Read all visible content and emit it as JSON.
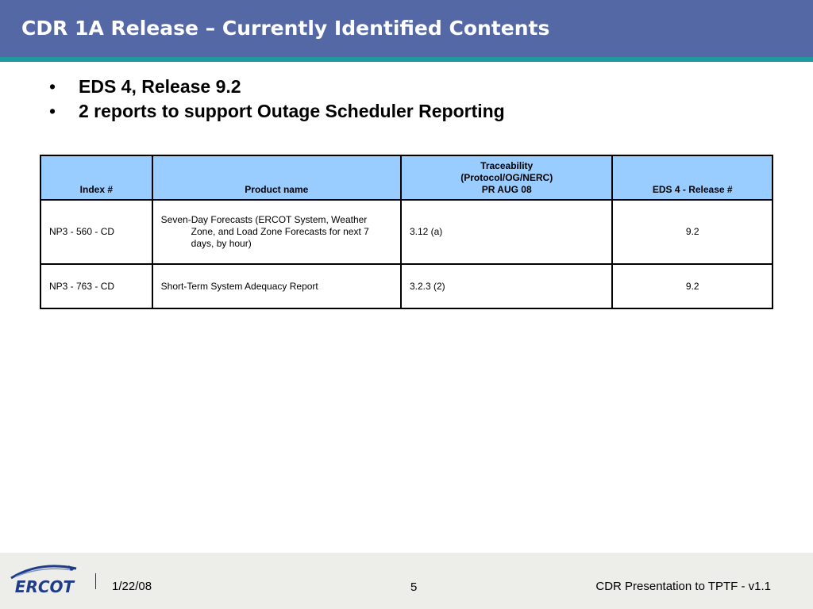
{
  "slide": {
    "title": "CDR 1A Release – Currently Identified Contents",
    "bullets": [
      "EDS 4, Release 9.2",
      "2 reports to support Outage Scheduler Reporting"
    ]
  },
  "table": {
    "headers": {
      "index": "Index #",
      "product": "Product name",
      "trace_line1": "Traceability",
      "trace_line2": "(Protocol/OG/NERC)",
      "trace_line3": "PR AUG 08",
      "release": "EDS 4 - Release #"
    },
    "rows": [
      {
        "index": "NP3 - 560 - CD",
        "product": "Seven-Day Forecasts (ERCOT System, Weather Zone, and Load Zone Forecasts for next 7 days, by hour)",
        "trace": "3.12 (a)",
        "release": "9.2"
      },
      {
        "index": "NP3 - 763 - CD",
        "product": "Short-Term System Adequacy Report",
        "trace": "3.2.3 (2)",
        "release": "9.2"
      }
    ]
  },
  "footer": {
    "logo_text": "ERCOT",
    "date": "1/22/08",
    "page_number": "5",
    "presentation": "CDR Presentation to TPTF - v1.1"
  },
  "colors": {
    "title_bar": "#5468a6",
    "accent_line": "#1e9aa0",
    "header_fill": "#99ccff",
    "logo_blue": "#1f3c88"
  }
}
